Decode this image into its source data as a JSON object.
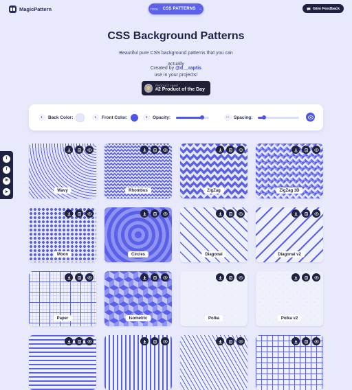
{
  "brand": {
    "name": "MagicPattern"
  },
  "tool_selector": {
    "tag": "TOOL:",
    "value": "CSS PATTERNS"
  },
  "feedback": {
    "label": "Give Feedback"
  },
  "hero": {
    "title": "CSS Background Patterns",
    "subtitle_line1": "Beautiful pure CSS background patterns that you can actually",
    "subtitle_line2": "use in your projects!",
    "created_prefix": "Created by",
    "author": "@d__raptis"
  },
  "product_hunt": {
    "top": "PRODUCT HUNT",
    "bottom": "#2 Product of the Day"
  },
  "controls": {
    "back_color_label": "Back Color:",
    "back_color": "#e5e7fb",
    "front_color_label": "Front Color:",
    "front_color": "#4f56e6",
    "opacity_label": "Opacity:",
    "opacity": 0.8,
    "spacing_label": "Spacing:",
    "spacing": 0.15
  },
  "social": [
    {
      "icon": "twitter-icon",
      "glyph": "t"
    },
    {
      "icon": "facebook-icon",
      "glyph": "f"
    },
    {
      "icon": "linkedin-icon",
      "glyph": "in"
    },
    {
      "icon": "telegram-icon",
      "glyph": "➤"
    }
  ],
  "patterns": [
    {
      "label": "Wavy",
      "style": "wavy"
    },
    {
      "label": "Rhombus",
      "style": "rhombus"
    },
    {
      "label": "ZigZag",
      "style": "zigzag"
    },
    {
      "label": "ZigZag 3D",
      "style": "zigzag3d"
    },
    {
      "label": "Moon",
      "style": "moon"
    },
    {
      "label": "Circles",
      "style": "circles"
    },
    {
      "label": "Diagonal",
      "style": "diagonal"
    },
    {
      "label": "Diagonal v2",
      "style": "diagonal2"
    },
    {
      "label": "Paper",
      "style": "paper"
    },
    {
      "label": "Isometric",
      "style": "isometric"
    },
    {
      "label": "Polka",
      "style": "polka"
    },
    {
      "label": "Polka v2",
      "style": "polka2"
    },
    {
      "label": "",
      "style": "lines-h"
    },
    {
      "label": "",
      "style": "lines-v"
    },
    {
      "label": "",
      "style": "lines-d"
    },
    {
      "label": "",
      "style": "grid"
    }
  ],
  "colors": {
    "accent": "#4f56e6",
    "dark": "#1e2140",
    "background": "#e8e9fa"
  }
}
